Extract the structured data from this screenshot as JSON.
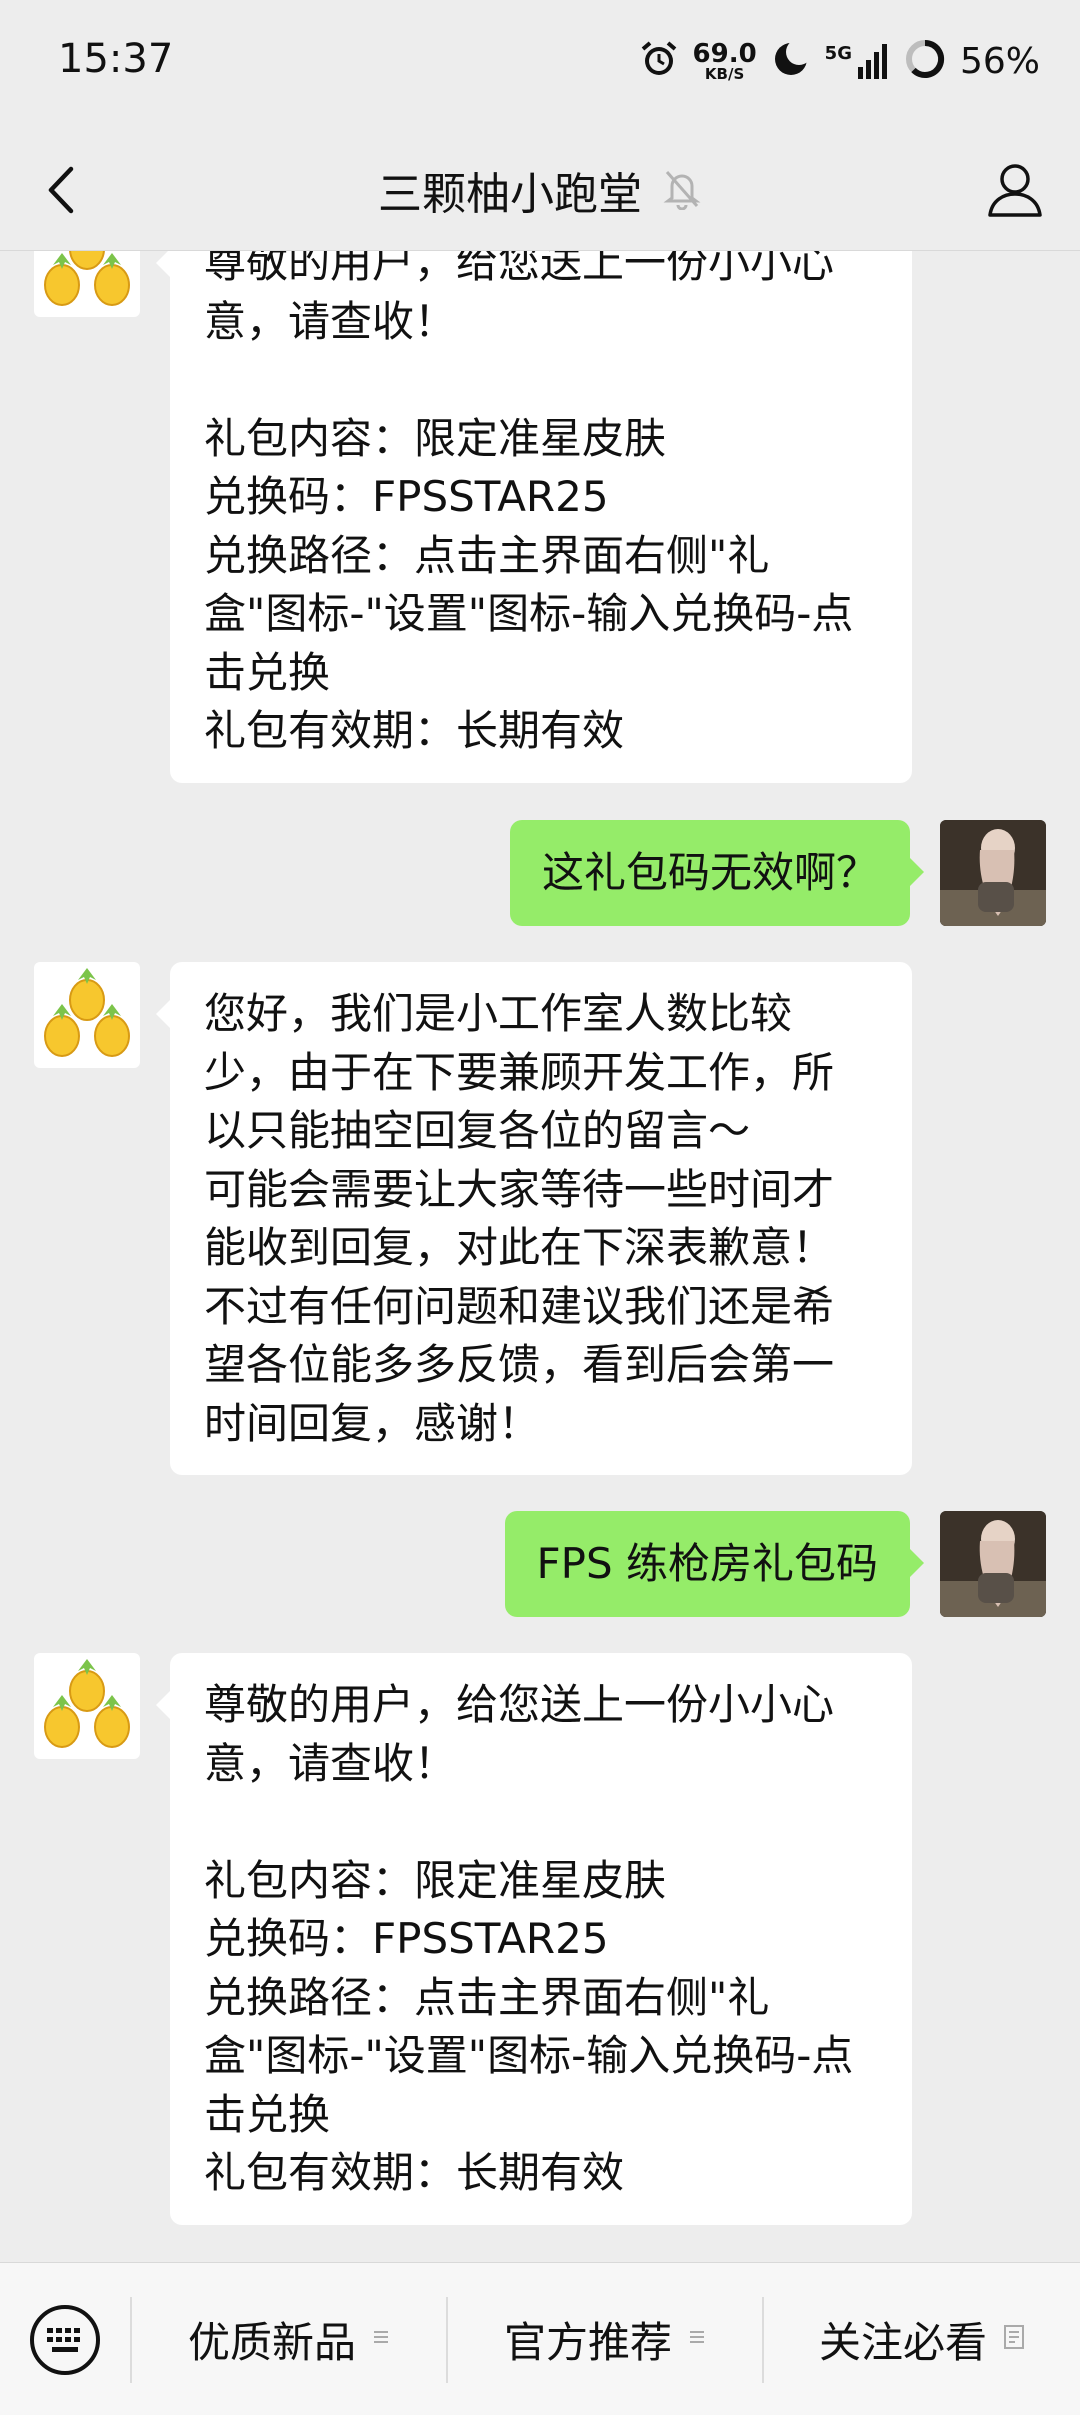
{
  "status_bar": {
    "time": "15:37",
    "net_speed": "69.0",
    "net_unit": "KB/S",
    "network": "5G",
    "battery": "56%",
    "icons": [
      "alarm-icon",
      "moon-icon",
      "signal-icon",
      "battery-ring-icon"
    ]
  },
  "header": {
    "title": "三颗柚小跑堂",
    "icons": [
      "back-icon",
      "mute-bell-icon",
      "profile-icon"
    ]
  },
  "messages": [
    {
      "direction": "in",
      "lines": [
        "尊敬的用户，给您送上一份小小心",
        "意，请查收！",
        "",
        "礼包内容：限定准星皮肤",
        "兑换码：FPSSTAR25",
        "兑换路径：点击主界面右侧\"礼",
        "盒\"图标-\"设置\"图标-输入兑换码-点",
        "击兑换",
        "礼包有效期：长期有效"
      ]
    },
    {
      "direction": "out",
      "lines": [
        "这礼包码无效啊？"
      ]
    },
    {
      "direction": "in",
      "lines": [
        "您好，我们是小工作室人数比较",
        "少，由于在下要兼顾开发工作，所",
        "以只能抽空回复各位的留言～",
        "可能会需要让大家等待一些时间才",
        "能收到回复，对此在下深表歉意！",
        "不过有任何问题和建议我们还是希",
        "望各位能多多反馈，看到后会第一",
        "时间回复，感谢！"
      ]
    },
    {
      "direction": "out",
      "lines": [
        "FPS 练枪房礼包码"
      ]
    },
    {
      "direction": "in",
      "lines": [
        "尊敬的用户，给您送上一份小小心",
        "意，请查收！",
        "",
        "礼包内容：限定准星皮肤",
        "兑换码：FPSSTAR25",
        "兑换路径：点击主界面右侧\"礼",
        "盒\"图标-\"设置\"图标-输入兑换码-点",
        "击兑换",
        "礼包有效期：长期有效"
      ]
    }
  ],
  "bottom_menu": {
    "items": [
      {
        "label": "优质新品",
        "icon": "menu-lines-icon"
      },
      {
        "label": "官方推荐",
        "icon": "menu-lines-icon"
      },
      {
        "label": "关注必看",
        "icon": "article-icon"
      }
    ],
    "keyboard_icon": "keyboard-icon"
  },
  "colors": {
    "background": "#ededed",
    "outgoing_bubble": "#95ec69",
    "incoming_bubble": "#ffffff"
  }
}
